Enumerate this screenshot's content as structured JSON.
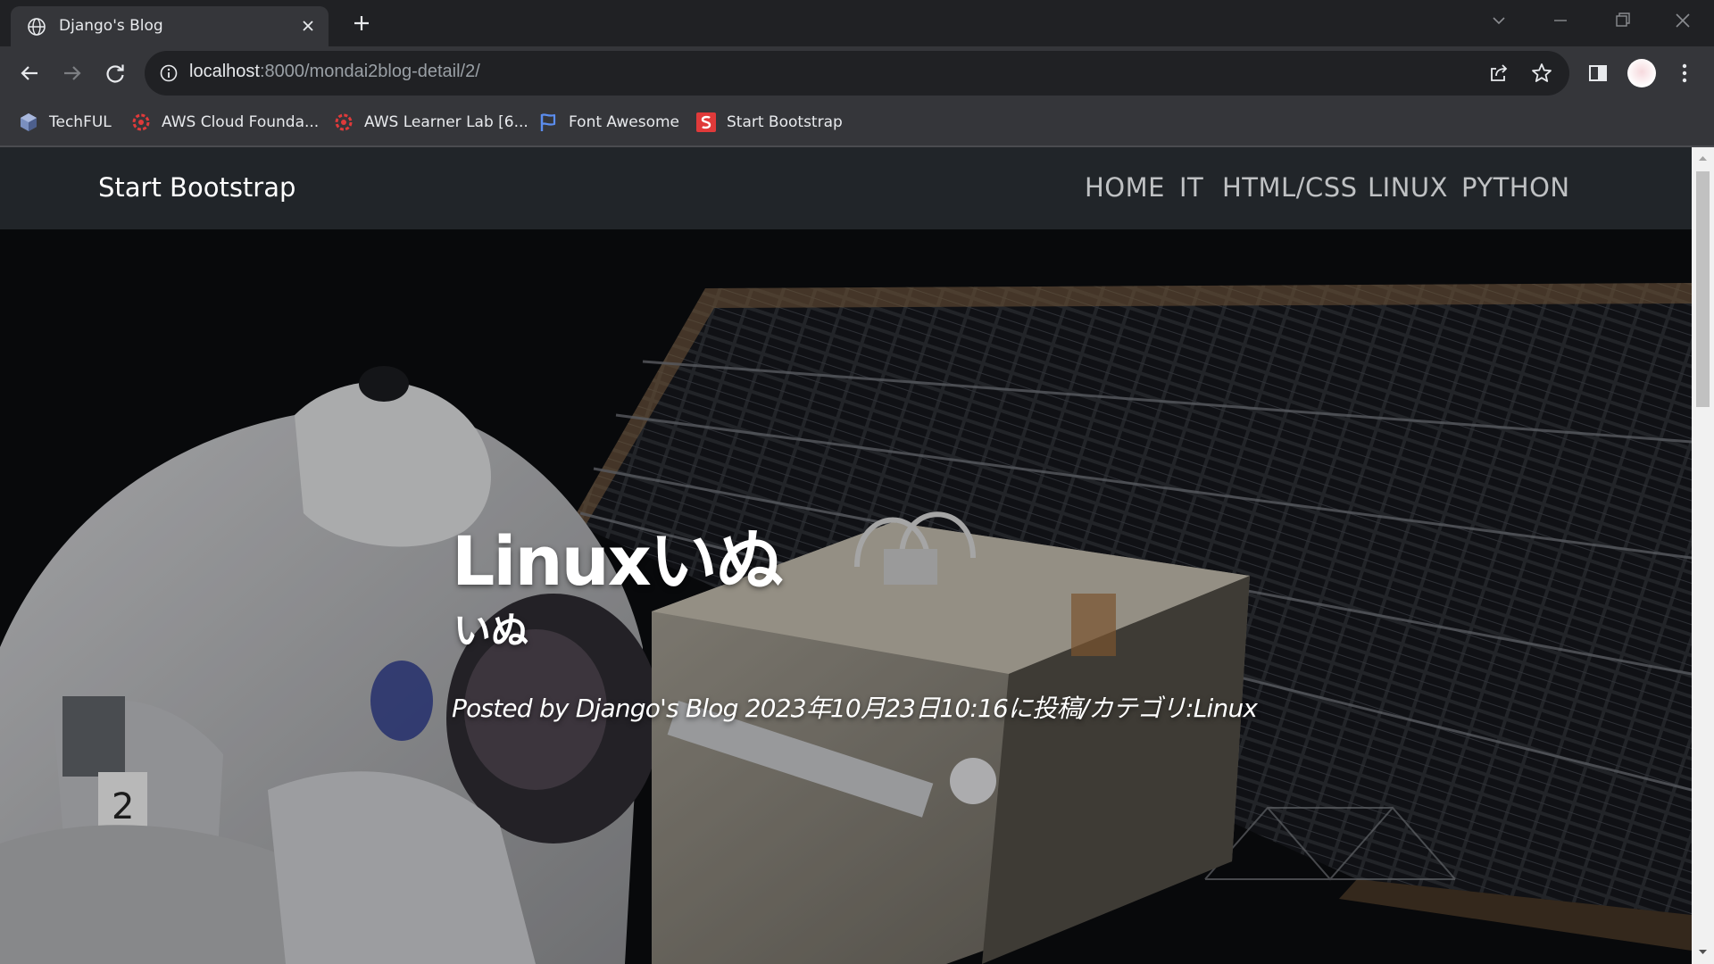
{
  "browser": {
    "tab": {
      "title": "Django's Blog"
    },
    "url": {
      "host": "localhost",
      "path": ":8000/mondai2blog-detail/2/"
    },
    "bookmarks": [
      {
        "label": "TechFUL",
        "icon": "cube-icon"
      },
      {
        "label": "AWS Cloud Founda...",
        "icon": "aws-academy-icon"
      },
      {
        "label": "AWS Learner Lab [6...",
        "icon": "aws-academy-icon"
      },
      {
        "label": "Font Awesome",
        "icon": "flag-icon"
      },
      {
        "label": "Start Bootstrap",
        "icon": "start-bootstrap-icon"
      }
    ]
  },
  "site": {
    "brand": "Start Bootstrap",
    "nav": [
      "HOME",
      "IT",
      "HTML/CSS",
      "LINUX",
      "PYTHON"
    ]
  },
  "post": {
    "heading": "Linuxいぬ",
    "subheading": "いぬ",
    "meta": "Posted by Django's Blog 2023年10月23日10:16に投稿/カテゴリ:Linux"
  },
  "colors": {
    "tab_active": "#35363a",
    "tabstrip": "#202124",
    "navbar": "#212529",
    "bookmark_red": "#e03a3a",
    "bookmark_blue": "#5b8def"
  }
}
